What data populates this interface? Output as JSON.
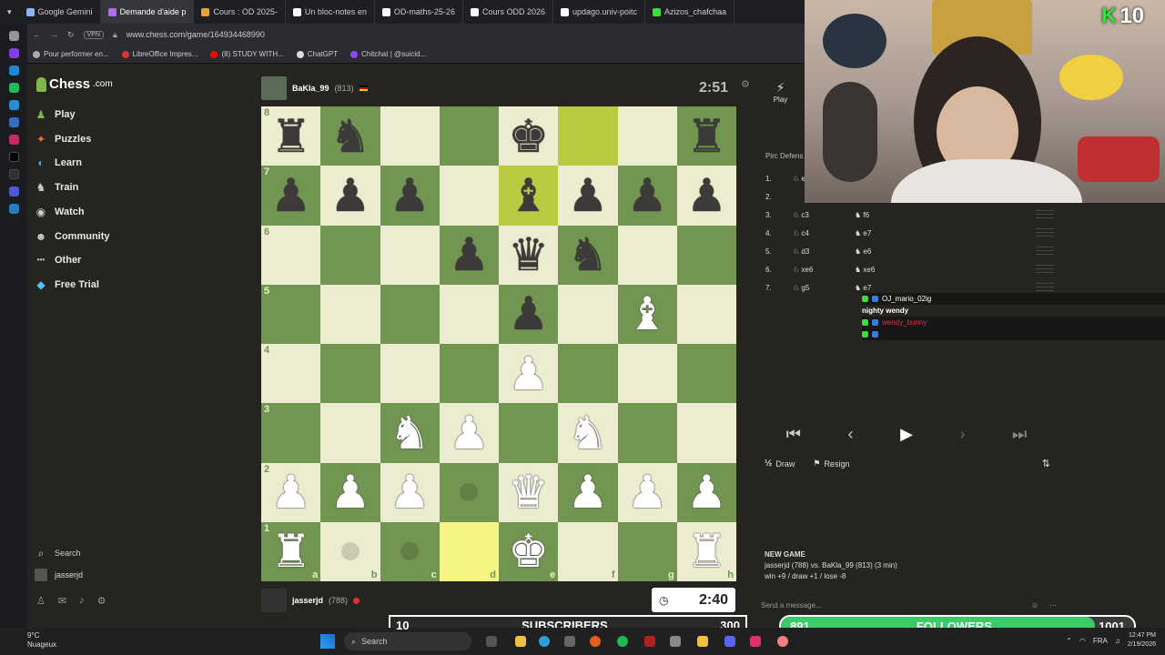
{
  "browser": {
    "tabs": [
      {
        "label": "Google Gemini",
        "color": "#8ab4f8",
        "active": false
      },
      {
        "label": "Demande d'aide p",
        "color": "#b36cf0",
        "active": true
      },
      {
        "label": "Cours : OD 2025-",
        "color": "#f0a030",
        "active": false
      },
      {
        "label": "Un bloc-notes en",
        "color": "#ffffff",
        "active": false
      },
      {
        "label": "OD-maths-25-26",
        "color": "#ffffff",
        "active": false
      },
      {
        "label": "Cours ODD 2026",
        "color": "#ffffff",
        "active": false
      },
      {
        "label": "updago.univ-poitc",
        "color": "#ffffff",
        "active": false
      },
      {
        "label": "Azizos_chafchaa",
        "color": "#35e03a",
        "active": false
      }
    ],
    "vpn": "VPN",
    "url": "www.chess.com/game/164934468990",
    "bookmarks": [
      {
        "label": "Pour performer en...",
        "color": "#aaa"
      },
      {
        "label": "LibreOffice Impres...",
        "color": "#e03030"
      },
      {
        "label": "(8) STUDY WITH...",
        "color": "#ff0000"
      },
      {
        "label": "ChatGPT",
        "color": "#ddd"
      },
      {
        "label": "Chitchat | @suicid...",
        "color": "#9146ff"
      }
    ]
  },
  "sidebar": {
    "logo": "Chess",
    "logo_suffix": ".com",
    "items": [
      {
        "label": "Play",
        "icon": "play-board-icon",
        "glyph": "♟",
        "color": "#81b64c"
      },
      {
        "label": "Puzzles",
        "icon": "puzzle-icon",
        "glyph": "✦",
        "color": "#f07030"
      },
      {
        "label": "Learn",
        "icon": "learn-icon",
        "glyph": "◐",
        "color": "#4fa3e0"
      },
      {
        "label": "Train",
        "icon": "train-icon",
        "glyph": "♞",
        "color": "#ccc"
      },
      {
        "label": "Watch",
        "icon": "watch-icon",
        "glyph": "◉",
        "color": "#ccc"
      },
      {
        "label": "Community",
        "icon": "community-icon",
        "glyph": "☻",
        "color": "#ccc"
      },
      {
        "label": "Other",
        "icon": "more-icon",
        "glyph": "•••",
        "color": "#ccc"
      },
      {
        "label": "Free Trial",
        "icon": "diamond-icon",
        "glyph": "◆",
        "color": "#4fc3f7"
      }
    ],
    "search_label": "Search",
    "username": "jasserjd"
  },
  "game": {
    "opponent": {
      "name": "BaKla_99",
      "rating": "(813)",
      "clock": "2:51"
    },
    "player": {
      "name": "jasserjd",
      "rating": "(788)",
      "clock": "2:40"
    },
    "files": [
      "a",
      "b",
      "c",
      "d",
      "e",
      "f",
      "g",
      "h"
    ],
    "board": [
      [
        "br",
        "bn",
        "",
        "",
        "bk",
        "",
        "",
        "br"
      ],
      [
        "bp",
        "bp",
        "bp",
        "",
        "bb",
        "bp",
        "bp",
        "bp"
      ],
      [
        "",
        "",
        "",
        "bp",
        "bq",
        "bn",
        "",
        ""
      ],
      [
        "",
        "",
        "",
        "",
        "bp",
        "",
        "wb",
        ""
      ],
      [
        "",
        "",
        "",
        "",
        "wp",
        "",
        "",
        ""
      ],
      [
        "",
        "",
        "wn",
        "wp",
        "",
        "wn",
        "",
        ""
      ],
      [
        "wp",
        "wp",
        "wp",
        "",
        "wq",
        "wp",
        "wp",
        "wp"
      ],
      [
        "wr",
        "",
        "",
        "",
        "wk",
        "",
        "",
        "wr"
      ]
    ],
    "highlights": [
      "f8",
      "e7",
      "d1"
    ],
    "move_dots": [
      "d2",
      "b1",
      "c1"
    ]
  },
  "moves_panel": {
    "play_label": "Play",
    "opening": "Pirc Defens",
    "moves": [
      {
        "n": "1.",
        "w": "e4",
        "b": ""
      },
      {
        "n": "2.",
        "w": "",
        "b": ""
      },
      {
        "n": "3.",
        "w": "c3",
        "b": "f6"
      },
      {
        "n": "4.",
        "w": "c4",
        "b": "e7"
      },
      {
        "n": "5.",
        "w": "d3",
        "b": "e6"
      },
      {
        "n": "6.",
        "w": "xe6",
        "b": "xe6"
      },
      {
        "n": "7.",
        "w": "g5",
        "b": "e7"
      }
    ],
    "draw": "Draw",
    "resign": "Resign",
    "new_game_title": "NEW GAME",
    "new_game_line": "jasserjd (788) vs. BaKla_99 (813) (3 min)",
    "new_game_stats": "win +9 / draw +1 / lose -8",
    "send_placeholder": "Send a message..."
  },
  "chat": [
    {
      "user": "OJ_mario_02ig",
      "text": "",
      "color": "#ffffff"
    },
    {
      "user": "",
      "text": "nighty wendy",
      "color": "#ffffff"
    },
    {
      "user": "wendy_bunny",
      "text": "",
      "color": "#e0304a"
    }
  ],
  "stream": {
    "badge_count": "10",
    "sub_current": "10",
    "sub_label": "SUBSCRIBERS",
    "sub_goal": "300",
    "sub_progress": 0.033,
    "fol_current": "891",
    "fol_label": "FOLLOWERS",
    "fol_goal": "1001",
    "fol_progress": 0.89
  },
  "taskbar": {
    "temp": "9°C",
    "weather": "Nuageux",
    "search": "Search",
    "lang": "FRA",
    "time": "12:47 PM",
    "date": "2/19/2026"
  }
}
